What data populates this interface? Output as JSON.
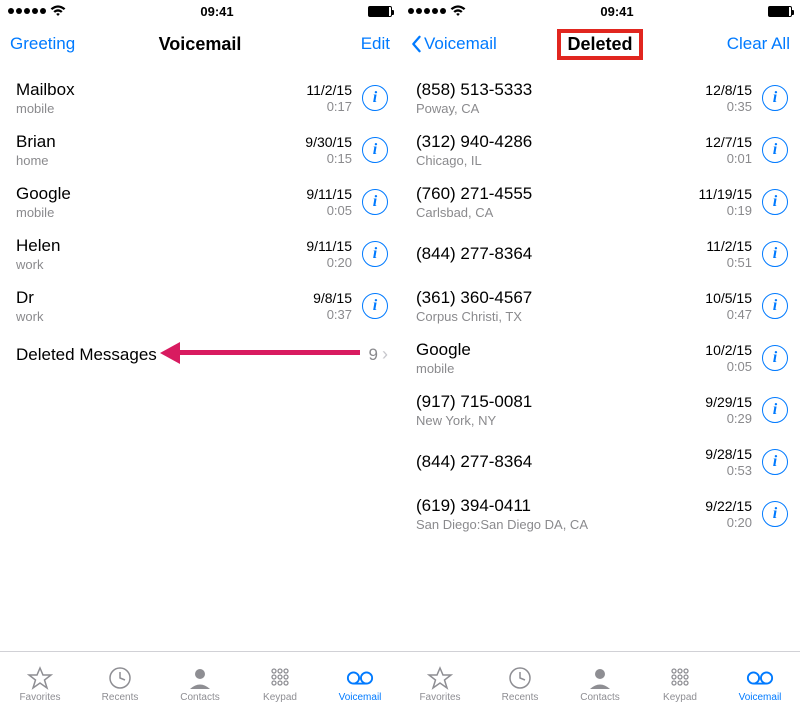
{
  "status": {
    "time": "09:41"
  },
  "left": {
    "nav": {
      "left": "Greeting",
      "title": "Voicemail",
      "right": "Edit"
    },
    "rows": [
      {
        "name": "Mailbox",
        "sub": "mobile",
        "date": "11/2/15",
        "dur": "0:17"
      },
      {
        "name": "Brian",
        "sub": "home",
        "date": "9/30/15",
        "dur": "0:15"
      },
      {
        "name": "Google",
        "sub": "mobile",
        "date": "9/11/15",
        "dur": "0:05"
      },
      {
        "name": "Helen",
        "sub": "work",
        "date": "9/11/15",
        "dur": "0:20"
      },
      {
        "name": "Dr",
        "sub": "work",
        "date": "9/8/15",
        "dur": "0:37"
      }
    ],
    "deleted": {
      "label": "Deleted Messages",
      "count": "9"
    }
  },
  "right": {
    "nav": {
      "back": "Voicemail",
      "title": "Deleted",
      "right": "Clear All"
    },
    "rows": [
      {
        "name": "(858) 513-5333",
        "sub": "Poway, CA",
        "date": "12/8/15",
        "dur": "0:35"
      },
      {
        "name": "(312) 940-4286",
        "sub": "Chicago, IL",
        "date": "12/7/15",
        "dur": "0:01"
      },
      {
        "name": "(760) 271-4555",
        "sub": "Carlsbad, CA",
        "date": "11/19/15",
        "dur": "0:19"
      },
      {
        "name": "(844) 277-8364",
        "sub": "",
        "date": "11/2/15",
        "dur": "0:51"
      },
      {
        "name": "(361) 360-4567",
        "sub": "Corpus Christi, TX",
        "date": "10/5/15",
        "dur": "0:47"
      },
      {
        "name": "Google",
        "sub": "mobile",
        "date": "10/2/15",
        "dur": "0:05"
      },
      {
        "name": "(917) 715-0081",
        "sub": "New York, NY",
        "date": "9/29/15",
        "dur": "0:29"
      },
      {
        "name": "(844) 277-8364",
        "sub": "",
        "date": "9/28/15",
        "dur": "0:53"
      },
      {
        "name": "(619) 394-0411",
        "sub": "San Diego:San Diego DA, CA",
        "date": "9/22/15",
        "dur": "0:20"
      }
    ]
  },
  "tabs": {
    "items": [
      {
        "label": "Favorites",
        "active": false
      },
      {
        "label": "Recents",
        "active": false
      },
      {
        "label": "Contacts",
        "active": false
      },
      {
        "label": "Keypad",
        "active": false
      },
      {
        "label": "Voicemail",
        "active": true
      }
    ]
  }
}
